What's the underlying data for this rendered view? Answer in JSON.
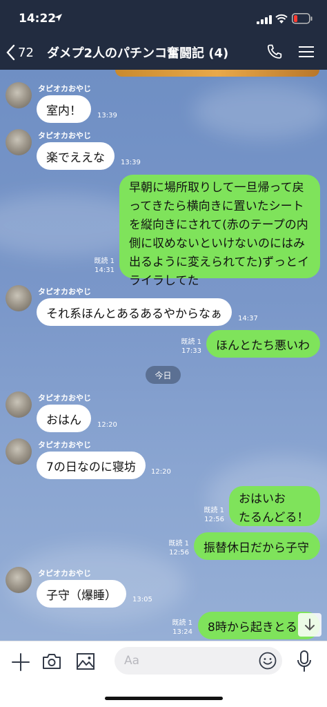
{
  "status_bar": {
    "time": "14:22"
  },
  "header": {
    "back_count": "72",
    "title": "ダメプ2人のパチンコ奮闘記 (4)"
  },
  "date_divider": "今日",
  "messages": [
    {
      "side": "in",
      "sender": "タピオカおやじ",
      "text": "室内！",
      "time": "13:39"
    },
    {
      "side": "in",
      "sender": "タピオカおやじ",
      "text": "楽でええな",
      "time": "13:39"
    },
    {
      "side": "out",
      "read": "既読 1",
      "time": "14:31",
      "lines": [
        "早朝に場所取りして一旦帰って戻",
        "ってきたら横向きに置いたシート",
        "を縦向きにされて(赤のテープの内",
        "側に収めないといけないのにはみ",
        "出るように変えられてた)ずっとイ",
        "ライラしてた"
      ]
    },
    {
      "side": "in",
      "sender": "タピオカおやじ",
      "text": "それ系ほんとあるあるやからなぁ",
      "time": "14:37"
    },
    {
      "side": "out",
      "read": "既読 1",
      "text": "ほんとたち悪いわ",
      "time": "17:33"
    },
    {
      "side": "in",
      "sender": "タピオカおやじ",
      "text": "おはん",
      "time": "12:20"
    },
    {
      "side": "in",
      "sender": "タピオカおやじ",
      "text": "7の日なのに寝坊",
      "time": "12:20"
    },
    {
      "side": "out",
      "read": "既読 1",
      "time": "12:56",
      "lines": [
        "おはいお",
        "たるんどる！"
      ]
    },
    {
      "side": "out",
      "read": "既読 1",
      "text": "振替休日だから子守",
      "time": "12:56"
    },
    {
      "side": "in",
      "sender": "タピオカおやじ",
      "text": "子守（爆睡）",
      "time": "13:05"
    },
    {
      "side": "out",
      "read": "既読 1",
      "text": "8時から起きとる",
      "time": "13:24"
    }
  ],
  "input": {
    "placeholder": "Aa"
  },
  "colors": {
    "header_bg": "#222c40",
    "outgoing_bubble": "#7fe35b",
    "incoming_bubble": "#ffffff",
    "chat_bg": "#7a97c9"
  }
}
